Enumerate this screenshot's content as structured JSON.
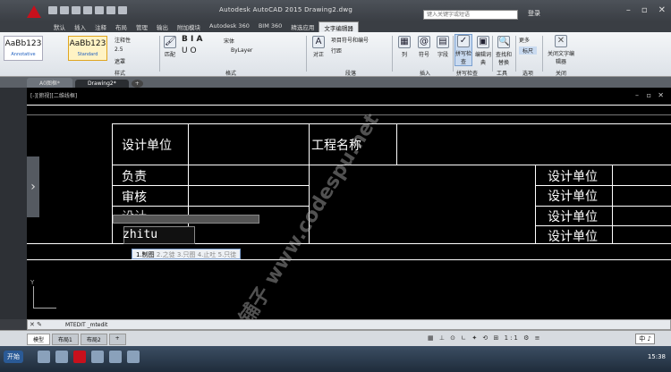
{
  "titlebar": {
    "title": "Autodesk AutoCAD 2015    Drawing2.dwg",
    "search_placeholder": "键入关键字或短语",
    "signin": "登录"
  },
  "menu": {
    "tabs": [
      "默认",
      "插入",
      "注释",
      "布局",
      "管理",
      "输出",
      "附加模块",
      "Autodesk 360",
      "BIM 360",
      "精选应用",
      "文字编辑器"
    ]
  },
  "ribbon": {
    "style1": {
      "name": "AaBb123",
      "label": "Annotative"
    },
    "style2": {
      "name": "AaBb123",
      "label": "Standard"
    },
    "annot_label": "注释性",
    "height_value": "2.5",
    "mask_label": "遮罩",
    "style_panel": "样式",
    "match_label": "匹配",
    "format_panel": "格式",
    "font_value": "宋体",
    "color_value": "ByLayer",
    "para_bullet": "项目符号和编号",
    "line_spacing": "行距",
    "align_label": "对正",
    "para_panel": "段落",
    "columns": "列",
    "symbol": "符号",
    "field": "字段",
    "insert_panel": "插入",
    "spell_label": "拼写检查",
    "dict_label": "编辑词典",
    "spell_panel": "拼写检查",
    "find_label": "查找和替换",
    "tools_panel": "工具",
    "more_label": "更多",
    "ruler_label": "标尺",
    "options_panel": "选项",
    "close_label": "关闭文字编辑器",
    "close_panel": "关闭"
  },
  "filetabs": [
    "A0图框*",
    "Drawing2*"
  ],
  "canvas": {
    "view_label": "[-][俯视][二维线框]",
    "cells": {
      "design_unit_left": "设计单位",
      "project_name": "工程名称",
      "responsible": "负责",
      "review": "审核",
      "design_partial": "设计",
      "right1": "设计单位",
      "right2": "设计单位",
      "right3": "设计单位",
      "right4": "设计单位"
    },
    "edit_text": "zhitu",
    "ime_first": "1.制图",
    "ime_rest": "2.之徒  3.只图  4.止吐  5.只徒",
    "ucs_y": "Y",
    "watermark": "源码铺子  www.codespu.net"
  },
  "command": {
    "text": "MTEDIT _mtedit"
  },
  "layout_tabs": [
    "模型",
    "布局1",
    "布局2"
  ],
  "status": {
    "scale": "1:1",
    "ime": "中 ♪"
  },
  "taskbar": {
    "start": "开始",
    "time": "15:38"
  }
}
